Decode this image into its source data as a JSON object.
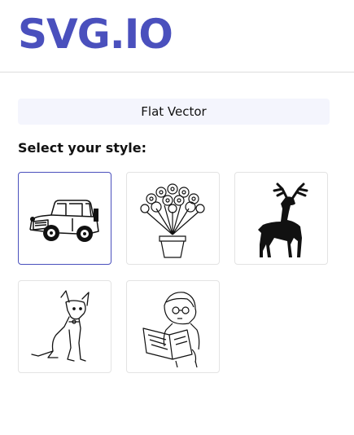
{
  "header": {
    "logo": "SVG.IO"
  },
  "style_selector": {
    "current_style": "Flat Vector",
    "prompt": "Select your style:"
  },
  "style_options": [
    {
      "subject": "car-icon",
      "selected": true
    },
    {
      "subject": "flower-vase-icon",
      "selected": false
    },
    {
      "subject": "deer-icon",
      "selected": false
    },
    {
      "subject": "dog-icon",
      "selected": false
    },
    {
      "subject": "girl-reading-icon",
      "selected": false
    }
  ],
  "colors": {
    "brand": "#4a50bd",
    "pill_bg": "#f4f5fd",
    "border": "#e3e3e3"
  }
}
